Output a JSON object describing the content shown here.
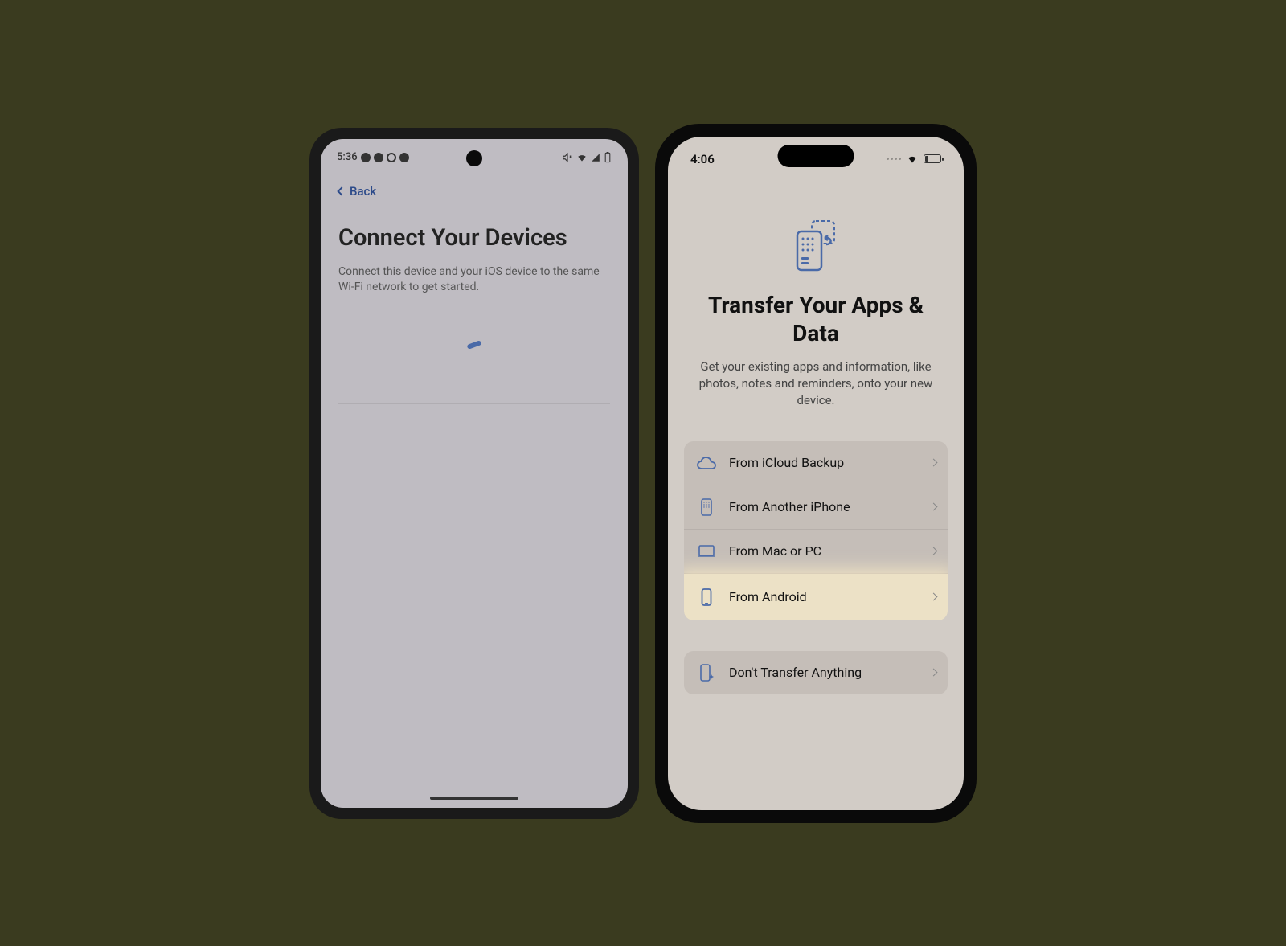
{
  "android": {
    "statusbar": {
      "time": "5:36"
    },
    "back_label": "Back",
    "title": "Connect Your Devices",
    "description": "Connect this device and your iOS device to the same Wi-Fi network to get started."
  },
  "iphone": {
    "statusbar": {
      "time": "4:06"
    },
    "title": "Transfer Your Apps & Data",
    "description": "Get your existing apps and information, like photos, notes and reminders, onto your new device.",
    "options": [
      {
        "label": "From iCloud Backup",
        "icon": "cloud"
      },
      {
        "label": "From Another iPhone",
        "icon": "iphone"
      },
      {
        "label": "From Mac or PC",
        "icon": "laptop"
      },
      {
        "label": "From Android",
        "icon": "android",
        "highlighted": true
      }
    ],
    "secondary_option": {
      "label": "Don't Transfer Anything",
      "icon": "sparkle-phone"
    }
  }
}
